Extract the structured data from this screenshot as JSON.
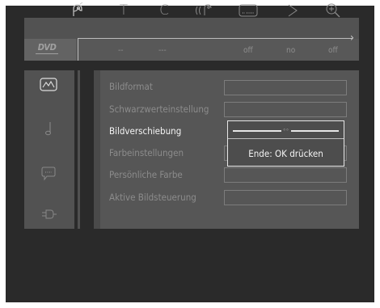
{
  "toolbar": {
    "icons": [
      "remote-icon",
      "title-icon",
      "chapter-icon",
      "audio-icon",
      "subtitle-icon",
      "angle-icon",
      "zoom-icon"
    ],
    "glyphs": {
      "title": "T",
      "chapter": "C"
    }
  },
  "status": {
    "logo": "DVD",
    "values": [
      "--",
      "---",
      "off",
      "no",
      "off"
    ]
  },
  "sidebar": {
    "icons": [
      "picture-icon",
      "music-icon",
      "speech-bubble-icon",
      "settings-plug-icon"
    ]
  },
  "menu": {
    "items": [
      {
        "label": "Bildformat",
        "active": false
      },
      {
        "label": "Schwarzwerteinstellung",
        "active": false
      },
      {
        "label": "Bildverschiebung",
        "active": true
      },
      {
        "label": "Farbeinstellungen",
        "active": false
      },
      {
        "label": "Persönliche Farbe",
        "active": false
      },
      {
        "label": "Aktive Bildsteuerung",
        "active": false
      }
    ]
  },
  "popup": {
    "knob": "◦◦",
    "hint": "Ende: OK drücken",
    "slider_position": 0.5
  },
  "colors": {
    "active_text": "#f4f4f4",
    "inactive_text": "#8c8c8c",
    "panel": "#565656"
  }
}
